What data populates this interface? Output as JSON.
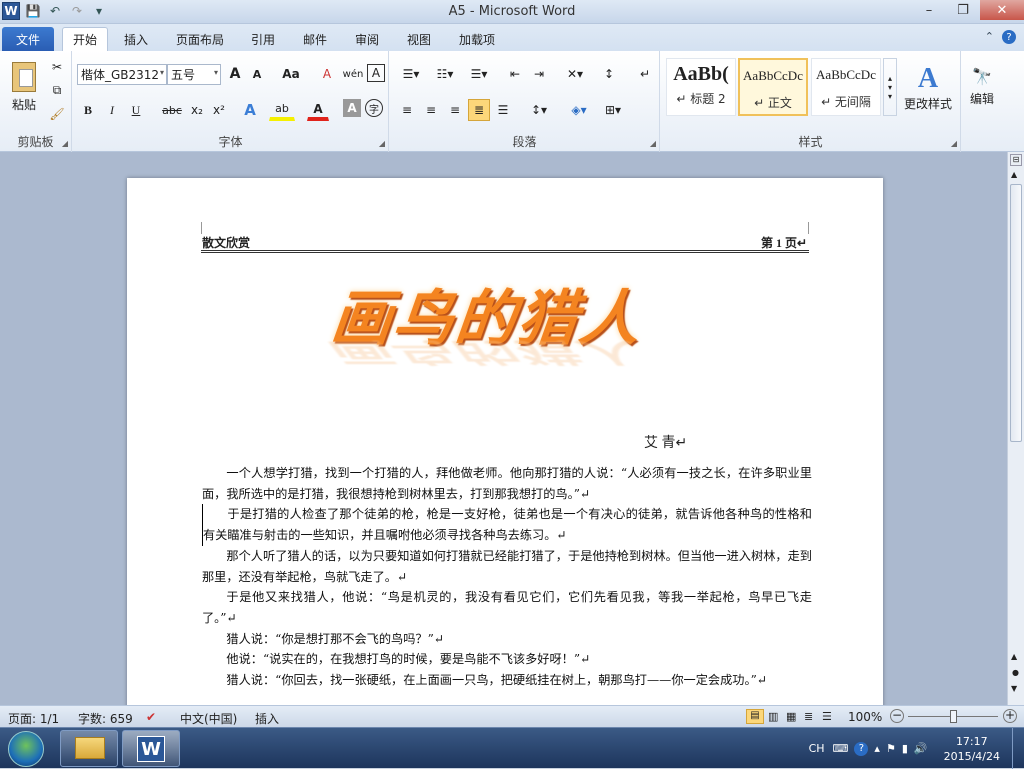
{
  "window": {
    "title": "A5 - Microsoft Word",
    "minimize": "–",
    "maximize": "❐",
    "close": "✕"
  },
  "qat": {
    "app_icon": "W",
    "save": "💾",
    "undo": "↶",
    "redo": "↷",
    "customize": "▾"
  },
  "tabs": [
    {
      "label": "文件"
    },
    {
      "label": "开始"
    },
    {
      "label": "插入"
    },
    {
      "label": "页面布局"
    },
    {
      "label": "引用"
    },
    {
      "label": "邮件"
    },
    {
      "label": "审阅"
    },
    {
      "label": "视图"
    },
    {
      "label": "加载项"
    }
  ],
  "ribbon": {
    "clipboard": {
      "paste": "粘贴",
      "label": "剪贴板"
    },
    "font": {
      "name": "楷体_GB2312",
      "size": "五号",
      "label": "字体",
      "grow": "A",
      "shrink": "A",
      "change_case": "Aa",
      "clear": "A",
      "phonetic": "wén",
      "border_char": "A",
      "bold": "B",
      "italic": "I",
      "underline": "U",
      "strike": "abc",
      "sub": "x₂",
      "sup": "x²",
      "effects": "A",
      "highlight": "ab",
      "font_color": "A",
      "shading": "A",
      "enclose": "字"
    },
    "paragraph": {
      "label": "段落"
    },
    "styles": {
      "label": "样式",
      "items": [
        {
          "preview": "AaBb(",
          "name": "↵ 标题 2"
        },
        {
          "preview": "AaBbCcDc",
          "name": "↵ 正文"
        },
        {
          "preview": "AaBbCcDc",
          "name": "↵ 无间隔"
        }
      ],
      "change_styles": "更改样式"
    },
    "editing": {
      "label": "编辑"
    }
  },
  "document": {
    "header_left": "散文欣赏",
    "header_right": "第 1 页↵",
    "title_art": "画鸟的猎人",
    "author": "艾 青↵",
    "paragraphs": [
      "一个人想学打猎，找到一个打猎的人，拜他做老师。他向那打猎的人说：“人必须有一技之长，在许多职业里面，我所选中的是打猎，我很想持枪到树林里去，打到那我想打的鸟。”↵",
      "于是打猎的人检查了那个徒弟的枪，枪是一支好枪，徒弟也是一个有决心的徒弟，就告诉他各种鸟的性格和有关瞄准与射击的一些知识，并且嘱咐他必须寻找各种鸟去练习。↵",
      "那个人听了猎人的话，以为只要知道如何打猎就已经能打猎了，于是他持枪到树林。但当他一进入树林，走到那里，还没有举起枪，鸟就飞走了。↵",
      "于是他又来找猎人，他说：“鸟是机灵的，我没有看见它们，它们先看见我，等我一举起枪，鸟早已飞走了。”↵",
      "猎人说：“你是想打那不会飞的鸟吗？”↵",
      "他说：“说实在的，在我想打鸟的时候，要是鸟能不飞该多好呀！”↵",
      "猎人说：“你回去，找一张硬纸，在上面画一只鸟，把硬纸挂在树上，朝那鸟打——你一定会成功。”↵"
    ]
  },
  "status": {
    "page": "页面: 1/1",
    "words": "字数: 659",
    "lang": "中文(中国)",
    "mode": "插入",
    "zoom": "100%"
  },
  "taskbar": {
    "lang": "CH",
    "time": "17:17",
    "date": "2015/4/24"
  }
}
